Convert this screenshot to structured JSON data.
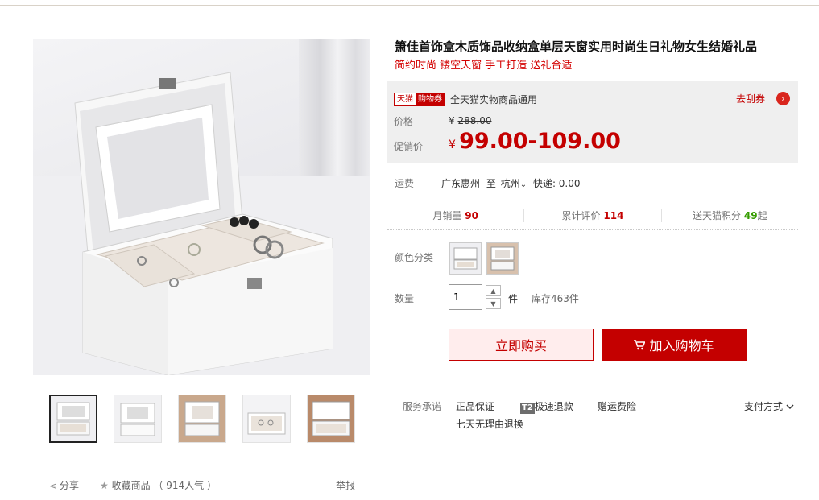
{
  "product": {
    "title": "箫佳首饰盒木质饰品收纳盒单层天窗实用时尚生日礼物女生结婚礼品",
    "subtitle": "简约时尚 镂空天窗 手工打造 送礼合适"
  },
  "coupon": {
    "tag_a": "天猫",
    "tag_b": "购物券",
    "text": "全天猫实物商品通用",
    "action": "去刮券",
    "action_icon": "chevron-right"
  },
  "price": {
    "orig_label": "价格",
    "currency": "¥",
    "orig_value": "288.00",
    "promo_label": "促销价",
    "promo_value": "99.00-109.00"
  },
  "freight": {
    "label": "运费",
    "from": "广东惠州",
    "to_word": "至",
    "to": "杭州",
    "fee": "快递: 0.00"
  },
  "stats": {
    "monthly_label": "月销量",
    "monthly_value": "90",
    "reviews_label": "累计评价",
    "reviews_value": "114",
    "points_label": "送天猫积分",
    "points_value": "49",
    "points_suffix": "起"
  },
  "options": {
    "color_label": "颜色分类",
    "qty_label": "数量",
    "qty_value": "1",
    "unit": "件",
    "stock": "库存463件"
  },
  "actions": {
    "buy_now": "立即购买",
    "add_cart": "加入购物车"
  },
  "service": {
    "label": "服务承诺",
    "item1": "正品保证",
    "t2_badge": "T2",
    "item2": "极速退款",
    "item3": "赠运费险",
    "item4": "七天无理由退换",
    "pay": "支付方式"
  },
  "gallery_bottom": {
    "share": "分享",
    "fav": "收藏商品",
    "popularity": "（ 914人气 ）",
    "report": "举报"
  },
  "colors": {
    "accent": "#c40000",
    "green": "#359c00",
    "panel_bg": "#efefef"
  }
}
